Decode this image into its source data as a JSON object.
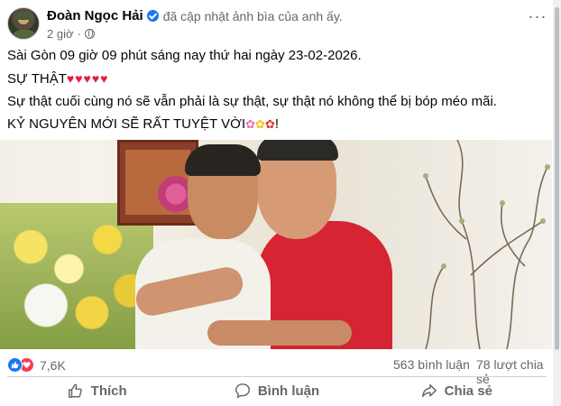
{
  "post": {
    "author": "Đoàn Ngọc Hải",
    "action": "đã cập nhật ảnh bìa của anh ấy.",
    "time": "2 giờ",
    "meta_separator": "·",
    "more_label": "···",
    "lines": {
      "line1": "Sài Gòn 09 giờ 09 phút sáng nay thứ hai ngày 23-02-2026.",
      "line2": "SỰ THẬT",
      "line2_hearts": "♥♥♥♥♥",
      "line3": "Sự thật cuối cùng nó sẽ vẫn phải là sự thật, sự thật nó không thể bị bóp méo mãi.",
      "line4": "KỶ NGUYÊN MỚI SẼ RẤT TUYỆT VỜI",
      "line4_emoji1": "✿",
      "line4_emoji2": "✿",
      "line4_emoji3": "✿",
      "line4_suffix": "!"
    },
    "icons": {
      "verified": "verified-badge-icon",
      "privacy": "globe-icon",
      "like_reaction": "like-reaction-icon",
      "love_reaction": "love-reaction-icon"
    }
  },
  "stats": {
    "reactions": "7,6K",
    "comments": "563 bình luận",
    "shares": "78 lượt chia sẻ"
  },
  "actions": {
    "like": "Thích",
    "comment": "Bình luận",
    "share": "Chia sẻ"
  },
  "colors": {
    "link_blue": "#1877f2",
    "love_red": "#f33e58",
    "secondary_text": "#65676b"
  }
}
